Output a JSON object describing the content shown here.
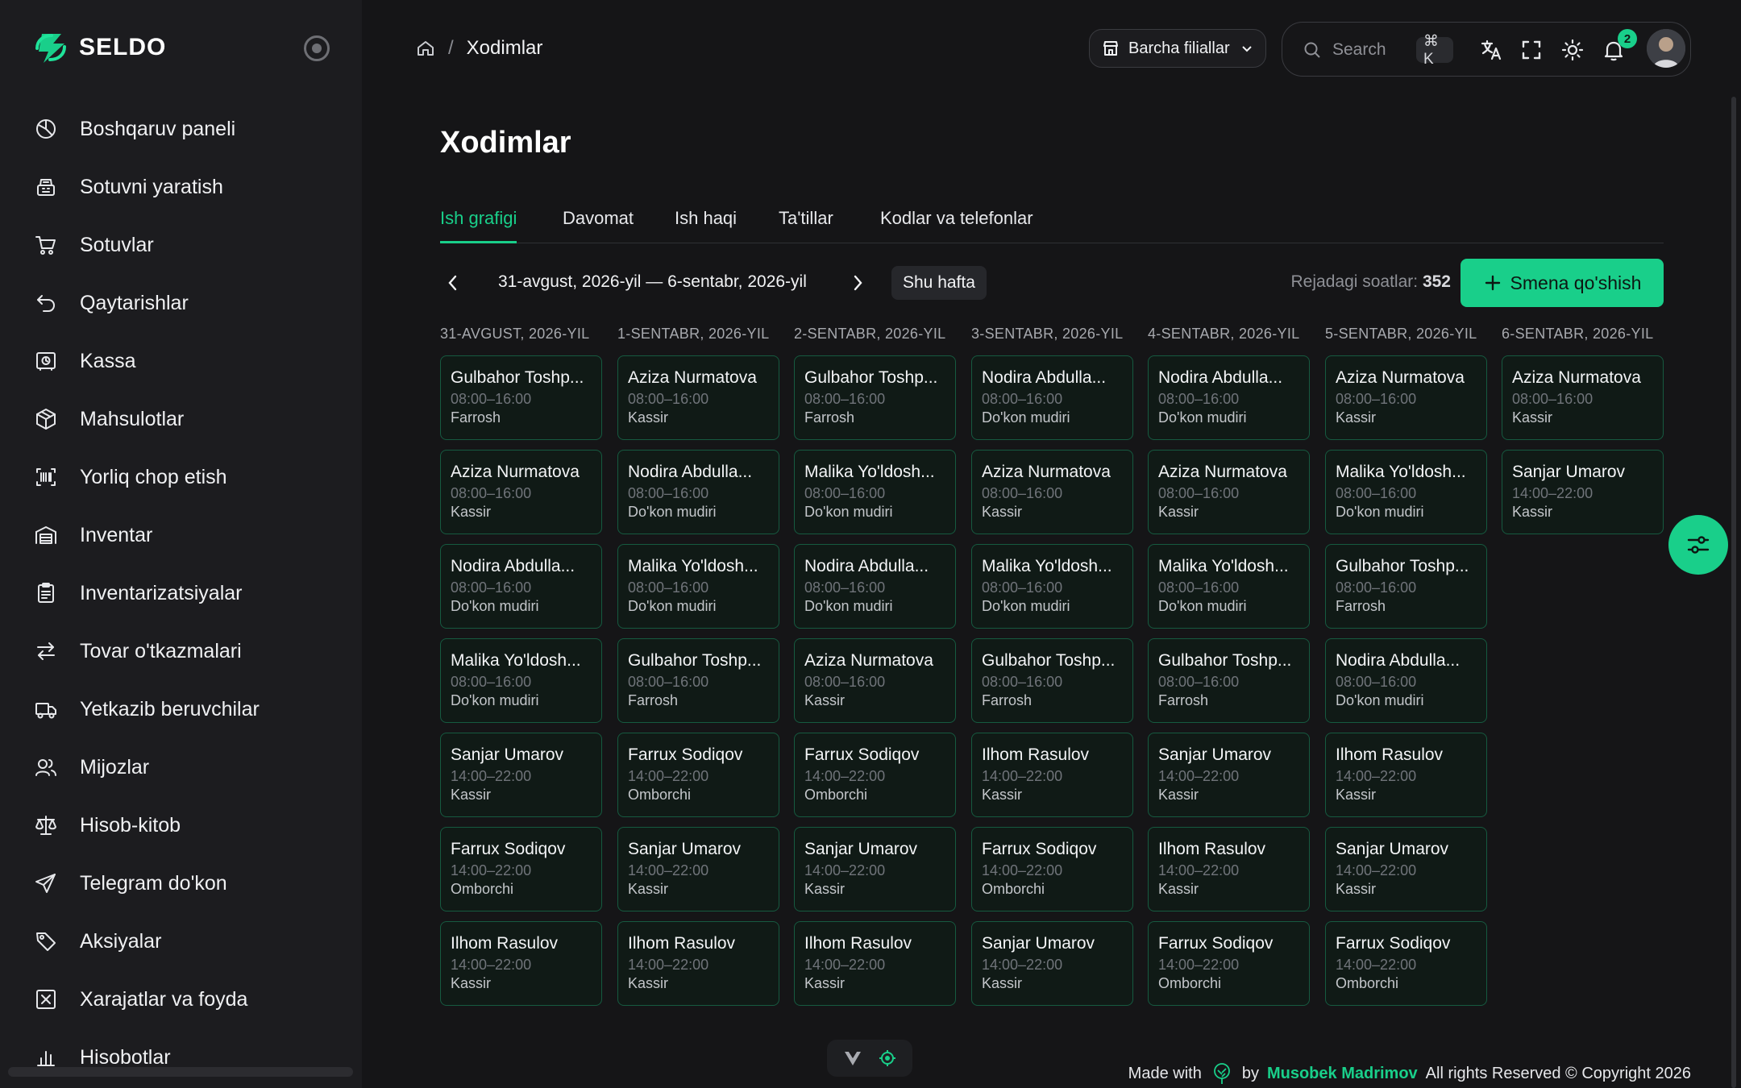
{
  "app": {
    "name": "SELDO",
    "accent": "#19cf8a"
  },
  "sidebar": {
    "items": [
      {
        "label": "Boshqaruv paneli",
        "icon": "dashboard-icon"
      },
      {
        "label": "Sotuvni yaratish",
        "icon": "cash-register-icon"
      },
      {
        "label": "Sotuvlar",
        "icon": "cart-icon"
      },
      {
        "label": "Qaytarishlar",
        "icon": "return-icon"
      },
      {
        "label": "Kassa",
        "icon": "safe-icon"
      },
      {
        "label": "Mahsulotlar",
        "icon": "box-icon"
      },
      {
        "label": "Yorliq chop etish",
        "icon": "barcode-icon"
      },
      {
        "label": "Inventar",
        "icon": "warehouse-icon"
      },
      {
        "label": "Inventarizatsiyalar",
        "icon": "clipboard-icon"
      },
      {
        "label": "Tovar o'tkazmalari",
        "icon": "transfer-icon"
      },
      {
        "label": "Yetkazib beruvchilar",
        "icon": "truck-icon"
      },
      {
        "label": "Mijozlar",
        "icon": "users-icon"
      },
      {
        "label": "Hisob-kitob",
        "icon": "scale-icon"
      },
      {
        "label": "Telegram do'kon",
        "icon": "send-icon"
      },
      {
        "label": "Aksiyalar",
        "icon": "tag-icon"
      },
      {
        "label": "Xarajatlar va foyda",
        "icon": "receipt-icon"
      },
      {
        "label": "Hisobotlar",
        "icon": "chart-icon"
      }
    ]
  },
  "header": {
    "breadcrumb_current": "Xodimlar",
    "branch_select": "Barcha filiallar",
    "search_placeholder": "Search",
    "search_shortcut": "⌘ K",
    "notification_count": "2"
  },
  "page": {
    "title": "Xodimlar",
    "tabs": [
      {
        "label": "Ish grafigi",
        "active": true
      },
      {
        "label": "Davomat"
      },
      {
        "label": "Ish haqi"
      },
      {
        "label": "Ta'tillar"
      },
      {
        "label": "Kodlar va telefonlar"
      }
    ],
    "range_label": "31-avgust, 2026-yil — 6-sentabr, 2026-yil",
    "this_week_label": "Shu hafta",
    "planned_hours_label": "Rejadagi soatlar:",
    "planned_hours_value": "352",
    "add_shift_label": "Smena qo'shish"
  },
  "schedule": {
    "days": [
      {
        "header": "31-AVGUST, 2026-YIL",
        "shifts": [
          {
            "name": "Gulbahor Toshp...",
            "time": "08:00–16:00",
            "role": "Farrosh"
          },
          {
            "name": "Aziza Nurmatova",
            "time": "08:00–16:00",
            "role": "Kassir"
          },
          {
            "name": "Nodira Abdulla...",
            "time": "08:00–16:00",
            "role": "Do'kon mudiri"
          },
          {
            "name": "Malika Yo'ldosh...",
            "time": "08:00–16:00",
            "role": "Do'kon mudiri"
          },
          {
            "name": "Sanjar Umarov",
            "time": "14:00–22:00",
            "role": "Kassir"
          },
          {
            "name": "Farrux Sodiqov",
            "time": "14:00–22:00",
            "role": "Omborchi"
          },
          {
            "name": "Ilhom Rasulov",
            "time": "14:00–22:00",
            "role": "Kassir"
          }
        ]
      },
      {
        "header": "1-SENTABR, 2026-YIL",
        "shifts": [
          {
            "name": "Aziza Nurmatova",
            "time": "08:00–16:00",
            "role": "Kassir"
          },
          {
            "name": "Nodira Abdulla...",
            "time": "08:00–16:00",
            "role": "Do'kon mudiri"
          },
          {
            "name": "Malika Yo'ldosh...",
            "time": "08:00–16:00",
            "role": "Do'kon mudiri"
          },
          {
            "name": "Gulbahor Toshp...",
            "time": "08:00–16:00",
            "role": "Farrosh"
          },
          {
            "name": "Farrux Sodiqov",
            "time": "14:00–22:00",
            "role": "Omborchi"
          },
          {
            "name": "Sanjar Umarov",
            "time": "14:00–22:00",
            "role": "Kassir"
          },
          {
            "name": "Ilhom Rasulov",
            "time": "14:00–22:00",
            "role": "Kassir"
          }
        ]
      },
      {
        "header": "2-SENTABR, 2026-YIL",
        "shifts": [
          {
            "name": "Gulbahor Toshp...",
            "time": "08:00–16:00",
            "role": "Farrosh"
          },
          {
            "name": "Malika Yo'ldosh...",
            "time": "08:00–16:00",
            "role": "Do'kon mudiri"
          },
          {
            "name": "Nodira Abdulla...",
            "time": "08:00–16:00",
            "role": "Do'kon mudiri"
          },
          {
            "name": "Aziza Nurmatova",
            "time": "08:00–16:00",
            "role": "Kassir"
          },
          {
            "name": "Farrux Sodiqov",
            "time": "14:00–22:00",
            "role": "Omborchi"
          },
          {
            "name": "Sanjar Umarov",
            "time": "14:00–22:00",
            "role": "Kassir"
          },
          {
            "name": "Ilhom Rasulov",
            "time": "14:00–22:00",
            "role": "Kassir"
          }
        ]
      },
      {
        "header": "3-SENTABR, 2026-YIL",
        "shifts": [
          {
            "name": "Nodira Abdulla...",
            "time": "08:00–16:00",
            "role": "Do'kon mudiri"
          },
          {
            "name": "Aziza Nurmatova",
            "time": "08:00–16:00",
            "role": "Kassir"
          },
          {
            "name": "Malika Yo'ldosh...",
            "time": "08:00–16:00",
            "role": "Do'kon mudiri"
          },
          {
            "name": "Gulbahor Toshp...",
            "time": "08:00–16:00",
            "role": "Farrosh"
          },
          {
            "name": "Ilhom Rasulov",
            "time": "14:00–22:00",
            "role": "Kassir"
          },
          {
            "name": "Farrux Sodiqov",
            "time": "14:00–22:00",
            "role": "Omborchi"
          },
          {
            "name": "Sanjar Umarov",
            "time": "14:00–22:00",
            "role": "Kassir"
          }
        ]
      },
      {
        "header": "4-SENTABR, 2026-YIL",
        "shifts": [
          {
            "name": "Nodira Abdulla...",
            "time": "08:00–16:00",
            "role": "Do'kon mudiri"
          },
          {
            "name": "Aziza Nurmatova",
            "time": "08:00–16:00",
            "role": "Kassir"
          },
          {
            "name": "Malika Yo'ldosh...",
            "time": "08:00–16:00",
            "role": "Do'kon mudiri"
          },
          {
            "name": "Gulbahor Toshp...",
            "time": "08:00–16:00",
            "role": "Farrosh"
          },
          {
            "name": "Sanjar Umarov",
            "time": "14:00–22:00",
            "role": "Kassir"
          },
          {
            "name": "Ilhom Rasulov",
            "time": "14:00–22:00",
            "role": "Kassir"
          },
          {
            "name": "Farrux Sodiqov",
            "time": "14:00–22:00",
            "role": "Omborchi"
          }
        ]
      },
      {
        "header": "5-SENTABR, 2026-YIL",
        "shifts": [
          {
            "name": "Aziza Nurmatova",
            "time": "08:00–16:00",
            "role": "Kassir"
          },
          {
            "name": "Malika Yo'ldosh...",
            "time": "08:00–16:00",
            "role": "Do'kon mudiri"
          },
          {
            "name": "Gulbahor Toshp...",
            "time": "08:00–16:00",
            "role": "Farrosh"
          },
          {
            "name": "Nodira Abdulla...",
            "time": "08:00–16:00",
            "role": "Do'kon mudiri"
          },
          {
            "name": "Ilhom Rasulov",
            "time": "14:00–22:00",
            "role": "Kassir"
          },
          {
            "name": "Sanjar Umarov",
            "time": "14:00–22:00",
            "role": "Kassir"
          },
          {
            "name": "Farrux Sodiqov",
            "time": "14:00–22:00",
            "role": "Omborchi"
          }
        ]
      },
      {
        "header": "6-SENTABR, 2026-YIL",
        "shifts": [
          {
            "name": "Aziza Nurmatova",
            "time": "08:00–16:00",
            "role": "Kassir"
          },
          {
            "name": "Sanjar Umarov",
            "time": "14:00–22:00",
            "role": "Kassir"
          }
        ]
      }
    ]
  },
  "footer": {
    "made_with": "Made with",
    "by": "by",
    "author": "Musobek Madrimov",
    "rights": "All rights Reserved © Copyright 2026"
  }
}
